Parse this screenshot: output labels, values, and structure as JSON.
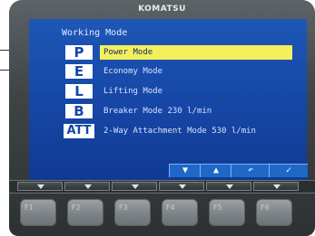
{
  "brand": "KOMATSU",
  "screen_title": "Working Mode",
  "modes": [
    {
      "code": "P",
      "label": "Power Mode",
      "selected": true
    },
    {
      "code": "E",
      "label": "Economy Mode",
      "selected": false
    },
    {
      "code": "L",
      "label": "Lifting Mode",
      "selected": false
    },
    {
      "code": "B",
      "label": "Breaker Mode  230 l/min",
      "selected": false
    },
    {
      "code": "ATT",
      "label": "2-Way Attachment Mode  530 l/min",
      "selected": false
    }
  ],
  "softkeys": {
    "down": "▼",
    "up": "▲",
    "back": "↶",
    "confirm": "✓"
  },
  "function_keys": [
    "F1",
    "F2",
    "F3",
    "F4",
    "F5",
    "F6"
  ],
  "colors": {
    "screen_blue": "#1646a6",
    "selection_yellow": "#f4f05b"
  }
}
